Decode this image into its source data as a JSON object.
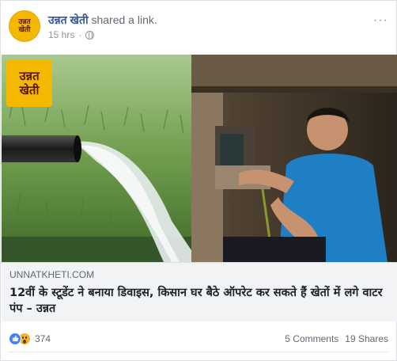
{
  "post": {
    "page_name": "उन्नत खेती",
    "action_text": "shared a link.",
    "time": "15 hrs",
    "privacy_icon": "globe-icon",
    "more_icon": "ellipsis-icon",
    "avatar_text_line1": "उन्नत",
    "avatar_text_line2": "खेती"
  },
  "media": {
    "logo_line1": "उन्नत",
    "logo_line2": "खेती"
  },
  "link": {
    "domain": "UNNATKHETI.COM",
    "headline": "12वीं के स्टूडेंट ने बनाया डिवाइस, किसान घर बैठे ऑपरेट कर सकते हैं खेतों में लगे वाटर पंप – उन्नत"
  },
  "engagement": {
    "reaction_icons": [
      "like-icon",
      "wow-icon"
    ],
    "reaction_count": "374",
    "comments": "5 Comments",
    "shares": "19 Shares"
  },
  "colors": {
    "link_blue": "#365899",
    "like_blue": "#4080ff",
    "brand_yellow": "#f5b800"
  }
}
